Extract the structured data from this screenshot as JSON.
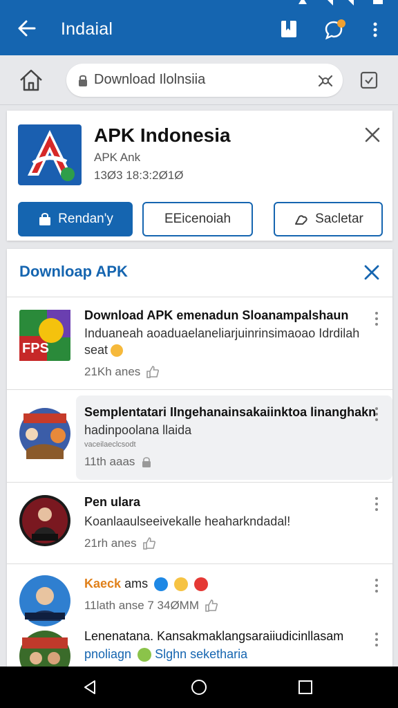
{
  "colors": {
    "primary": "#1565b0",
    "background": "#e6e7ea",
    "card": "#ffffff"
  },
  "appbar": {
    "title": "Indaial",
    "icons": [
      "back-arrow-icon",
      "bookmark-icon",
      "chat-icon",
      "more-vert-icon"
    ]
  },
  "address_bar": {
    "url": "Download Ilolnsiia",
    "icons": [
      "home-icon",
      "lock-icon",
      "reader-icon",
      "tabs-icon"
    ]
  },
  "app_card": {
    "name": "APK Indonesia",
    "subtitle": "APK Ank",
    "date": "13Ø3 18:3:2Ø1Ø",
    "buttons": {
      "primary": "Rendan'y",
      "secondary": "EEicenoiah",
      "tertiary": "Sacletar"
    }
  },
  "download_panel": {
    "title": "Downloap APK",
    "items": [
      {
        "title": "Download APK emenadun Sloanampalshaun",
        "description": "Induaneah aoaduaelaneliarjuinrinsimaoao Idrdilah",
        "description2": "seat",
        "meta": "21Kh anes"
      },
      {
        "title": "Semplentatari IIngehanainsakaiinktoa linanghakn",
        "description": "hadinpoolana llaida",
        "tiny": "vaceilaeclcsodt",
        "meta": "11th aaas"
      },
      {
        "title": "Pen ulara",
        "description": "Koanlaaulseeivekalle heaharkndadal!",
        "meta": "21rh anes"
      },
      {
        "title": "Kaeck",
        "title_suffix": "ams",
        "meta": "11lath anse 7 34ØMM"
      },
      {
        "title": "Lenenatana. Kansakmaklangsaraiiudicinllasam",
        "description_a": "pnoliagn",
        "description_b": "Slghn seketharia"
      }
    ]
  }
}
